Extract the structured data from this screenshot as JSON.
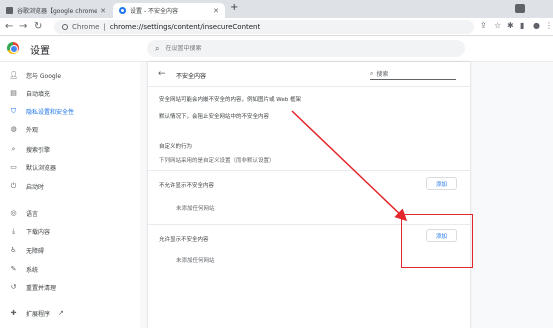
{
  "tabs": [
    {
      "label": "谷歌浏览器【google chrome】",
      "close": "✕"
    },
    {
      "label": "设置 - 不安全内容",
      "close": "✕"
    }
  ],
  "new_tab": "+",
  "address_bar": {
    "site": "Chrome",
    "path": "chrome://settings/content/insecureContent"
  },
  "settings_header": {
    "title": "设置",
    "search_placeholder": "在设置中搜索"
  },
  "sidebar": {
    "items": [
      {
        "label": "您与 Google",
        "icon": "person-icon"
      },
      {
        "label": "自动填充",
        "icon": "clipboard-icon"
      },
      {
        "label": "隐私设置和安全性",
        "icon": "shield-icon"
      },
      {
        "label": "外观",
        "icon": "palette-icon"
      },
      {
        "label": "搜索引擎",
        "icon": "search-icon"
      },
      {
        "label": "默认浏览器",
        "icon": "browser-icon"
      },
      {
        "label": "启动时",
        "icon": "power-icon"
      },
      {
        "label": "语言",
        "icon": "globe-icon"
      },
      {
        "label": "下载内容",
        "icon": "download-icon"
      },
      {
        "label": "无障碍",
        "icon": "accessibility-icon"
      },
      {
        "label": "系统",
        "icon": "wrench-icon"
      },
      {
        "label": "重置并清理",
        "icon": "reset-icon"
      },
      {
        "label": "扩展程序",
        "icon": "puzzle-icon"
      }
    ],
    "selected_index": 2
  },
  "main": {
    "subpage_title": "不安全内容",
    "search_placeholder": "搜索",
    "description_1": "安全网站可能会内嵌不安全的内容，例如图片或 Web 框架",
    "description_2": "默认情况下，会阻止安全网站中的不安全内容",
    "custom_behaviors_title": "自定义的行为",
    "custom_behaviors_desc": "下列网站采用的是自定义设置（而非默认设置）",
    "block_section": {
      "title": "不允许显示不安全内容",
      "add_label": "添加",
      "empty_text": "未添加任何网站"
    },
    "allow_section": {
      "title": "允许显示不安全内容",
      "add_label": "添加",
      "empty_text": "未添加任何网站"
    }
  },
  "colors": {
    "accent": "#1a73e8",
    "annotation": "#e3262b"
  }
}
